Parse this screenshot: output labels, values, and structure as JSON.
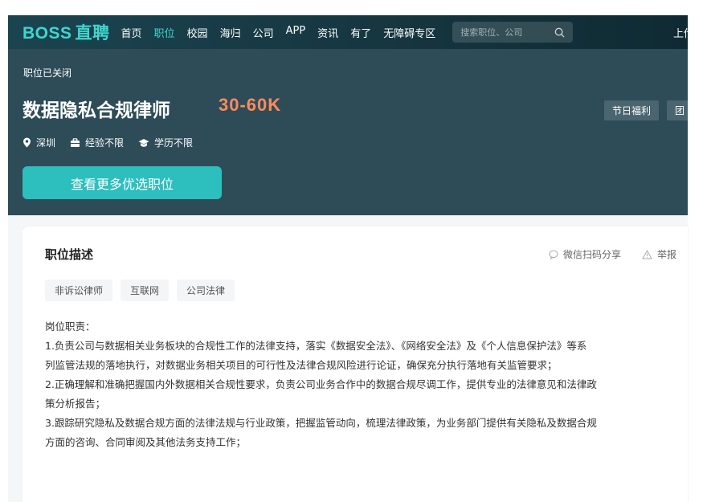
{
  "nav": {
    "logo_latin": "BOSS",
    "logo_zh": "直聘",
    "items": [
      {
        "label": "首页",
        "active": false
      },
      {
        "label": "职位",
        "active": true
      },
      {
        "label": "校园",
        "active": false
      },
      {
        "label": "海归",
        "active": false
      },
      {
        "label": "公司",
        "active": false
      },
      {
        "label": "APP",
        "active": false
      },
      {
        "label": "资讯",
        "active": false
      },
      {
        "label": "有了",
        "active": false
      },
      {
        "label": "无障碍专区",
        "active": false
      }
    ],
    "search_placeholder": "搜索职位、公司",
    "right_text": "上传"
  },
  "job": {
    "status": "职位已关闭",
    "title": "数据隐私合规律师",
    "salary": "30-60K",
    "benefits": [
      "节日福利",
      "团"
    ],
    "location": "深圳",
    "experience": "经验不限",
    "education": "学历不限",
    "cta_label": "查看更多优选职位"
  },
  "description": {
    "section_title": "职位描述",
    "share_label": "微信扫码分享",
    "report_label": "举报",
    "tags": [
      "非诉讼律师",
      "互联网",
      "公司法律"
    ],
    "lines": [
      "岗位职责：",
      "1.负责公司与数据相关业务板块的合规性工作的法律支持，落实《数据安全法》、《网络安全法》及《个人信息保护法》等系",
      "列监管法规的落地执行，对数据业务相关项目的可行性及法律合规风险进行论证，确保充分执行落地有关监管要求；",
      "2.正确理解和准确把握国内外数据相关合规性要求，负责公司业务合作中的数据合规尽调工作，提供专业的法律意见和法律政",
      "策分析报告；",
      "3.跟踪研究隐私及数据合规方面的法律法规与行业政策，把握监管动向，梳理法律政策，为业务部门提供有关隐私及数据合规",
      "方面的咨询、合同审阅及其他法务支持工作；"
    ]
  },
  "colors": {
    "nav_bg": "#163640",
    "banner_bg": "#2d4c58",
    "accent": "#3fd6cf",
    "salary": "#ff8a5c",
    "cta": "#2cbfbe"
  }
}
